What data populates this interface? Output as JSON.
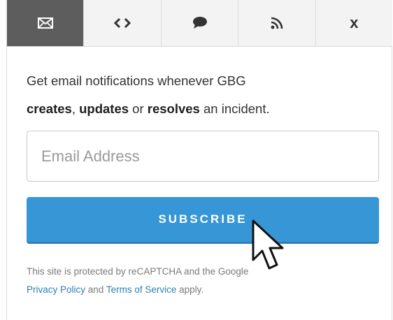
{
  "tabs": [
    {
      "icon": "envelope-icon",
      "active": true
    },
    {
      "icon": "code-brackets-icon",
      "active": false
    },
    {
      "icon": "chat-bubble-icon",
      "active": false
    },
    {
      "icon": "rss-feed-icon",
      "active": false
    },
    {
      "label": "x",
      "active": false
    }
  ],
  "description": {
    "line1": "Get email notifications whenever GBG",
    "creates": "creates",
    "sep1": ", ",
    "updates": "updates",
    "sep2": " or ",
    "resolves": "resolves",
    "tail": " an incident."
  },
  "email": {
    "placeholder": "Email Address",
    "value": ""
  },
  "subscribe_label": "SUBSCRIBE",
  "legal": {
    "prefix": "This site is protected by reCAPTCHA and the Google",
    "privacy_link": "Privacy Policy",
    "and": " and ",
    "terms_link": "Terms of Service",
    "suffix": " apply."
  },
  "colors": {
    "accent": "#3796d6",
    "active_tab": "#5d5d5d",
    "link": "#2f7fb8"
  }
}
